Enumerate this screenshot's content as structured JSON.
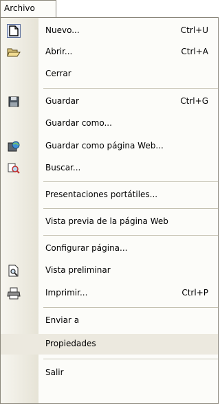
{
  "menubar": {
    "title": "Archivo"
  },
  "items": {
    "nuevo": {
      "label": "Nuevo...",
      "shortcut": "Ctrl+U",
      "icon": "new-document-icon"
    },
    "abrir": {
      "label": "Abrir...",
      "shortcut": "Ctrl+A",
      "icon": "open-folder-icon"
    },
    "cerrar": {
      "label": "Cerrar"
    },
    "guardar": {
      "label": "Guardar",
      "shortcut": "Ctrl+G",
      "icon": "save-disk-icon"
    },
    "guardar_como": {
      "label": "Guardar como..."
    },
    "guardar_web": {
      "label": "Guardar como página Web...",
      "icon": "save-web-icon"
    },
    "buscar": {
      "label": "Buscar...",
      "icon": "search-file-icon"
    },
    "presentaciones": {
      "label": "Presentaciones portátiles..."
    },
    "vista_previa_web": {
      "label": "Vista previa de la página Web"
    },
    "configurar": {
      "label": "Configurar página..."
    },
    "vista_preliminar": {
      "label": "Vista preliminar",
      "icon": "print-preview-icon"
    },
    "imprimir": {
      "label": "Imprimir...",
      "shortcut": "Ctrl+P",
      "icon": "printer-icon"
    },
    "enviar": {
      "label": "Enviar a"
    },
    "propiedades": {
      "label": "Propiedades"
    },
    "salir": {
      "label": "Salir"
    }
  },
  "colors": {
    "gutter": "#e6e3d6",
    "border": "#8a867a",
    "separator": "#c5c2b2"
  }
}
